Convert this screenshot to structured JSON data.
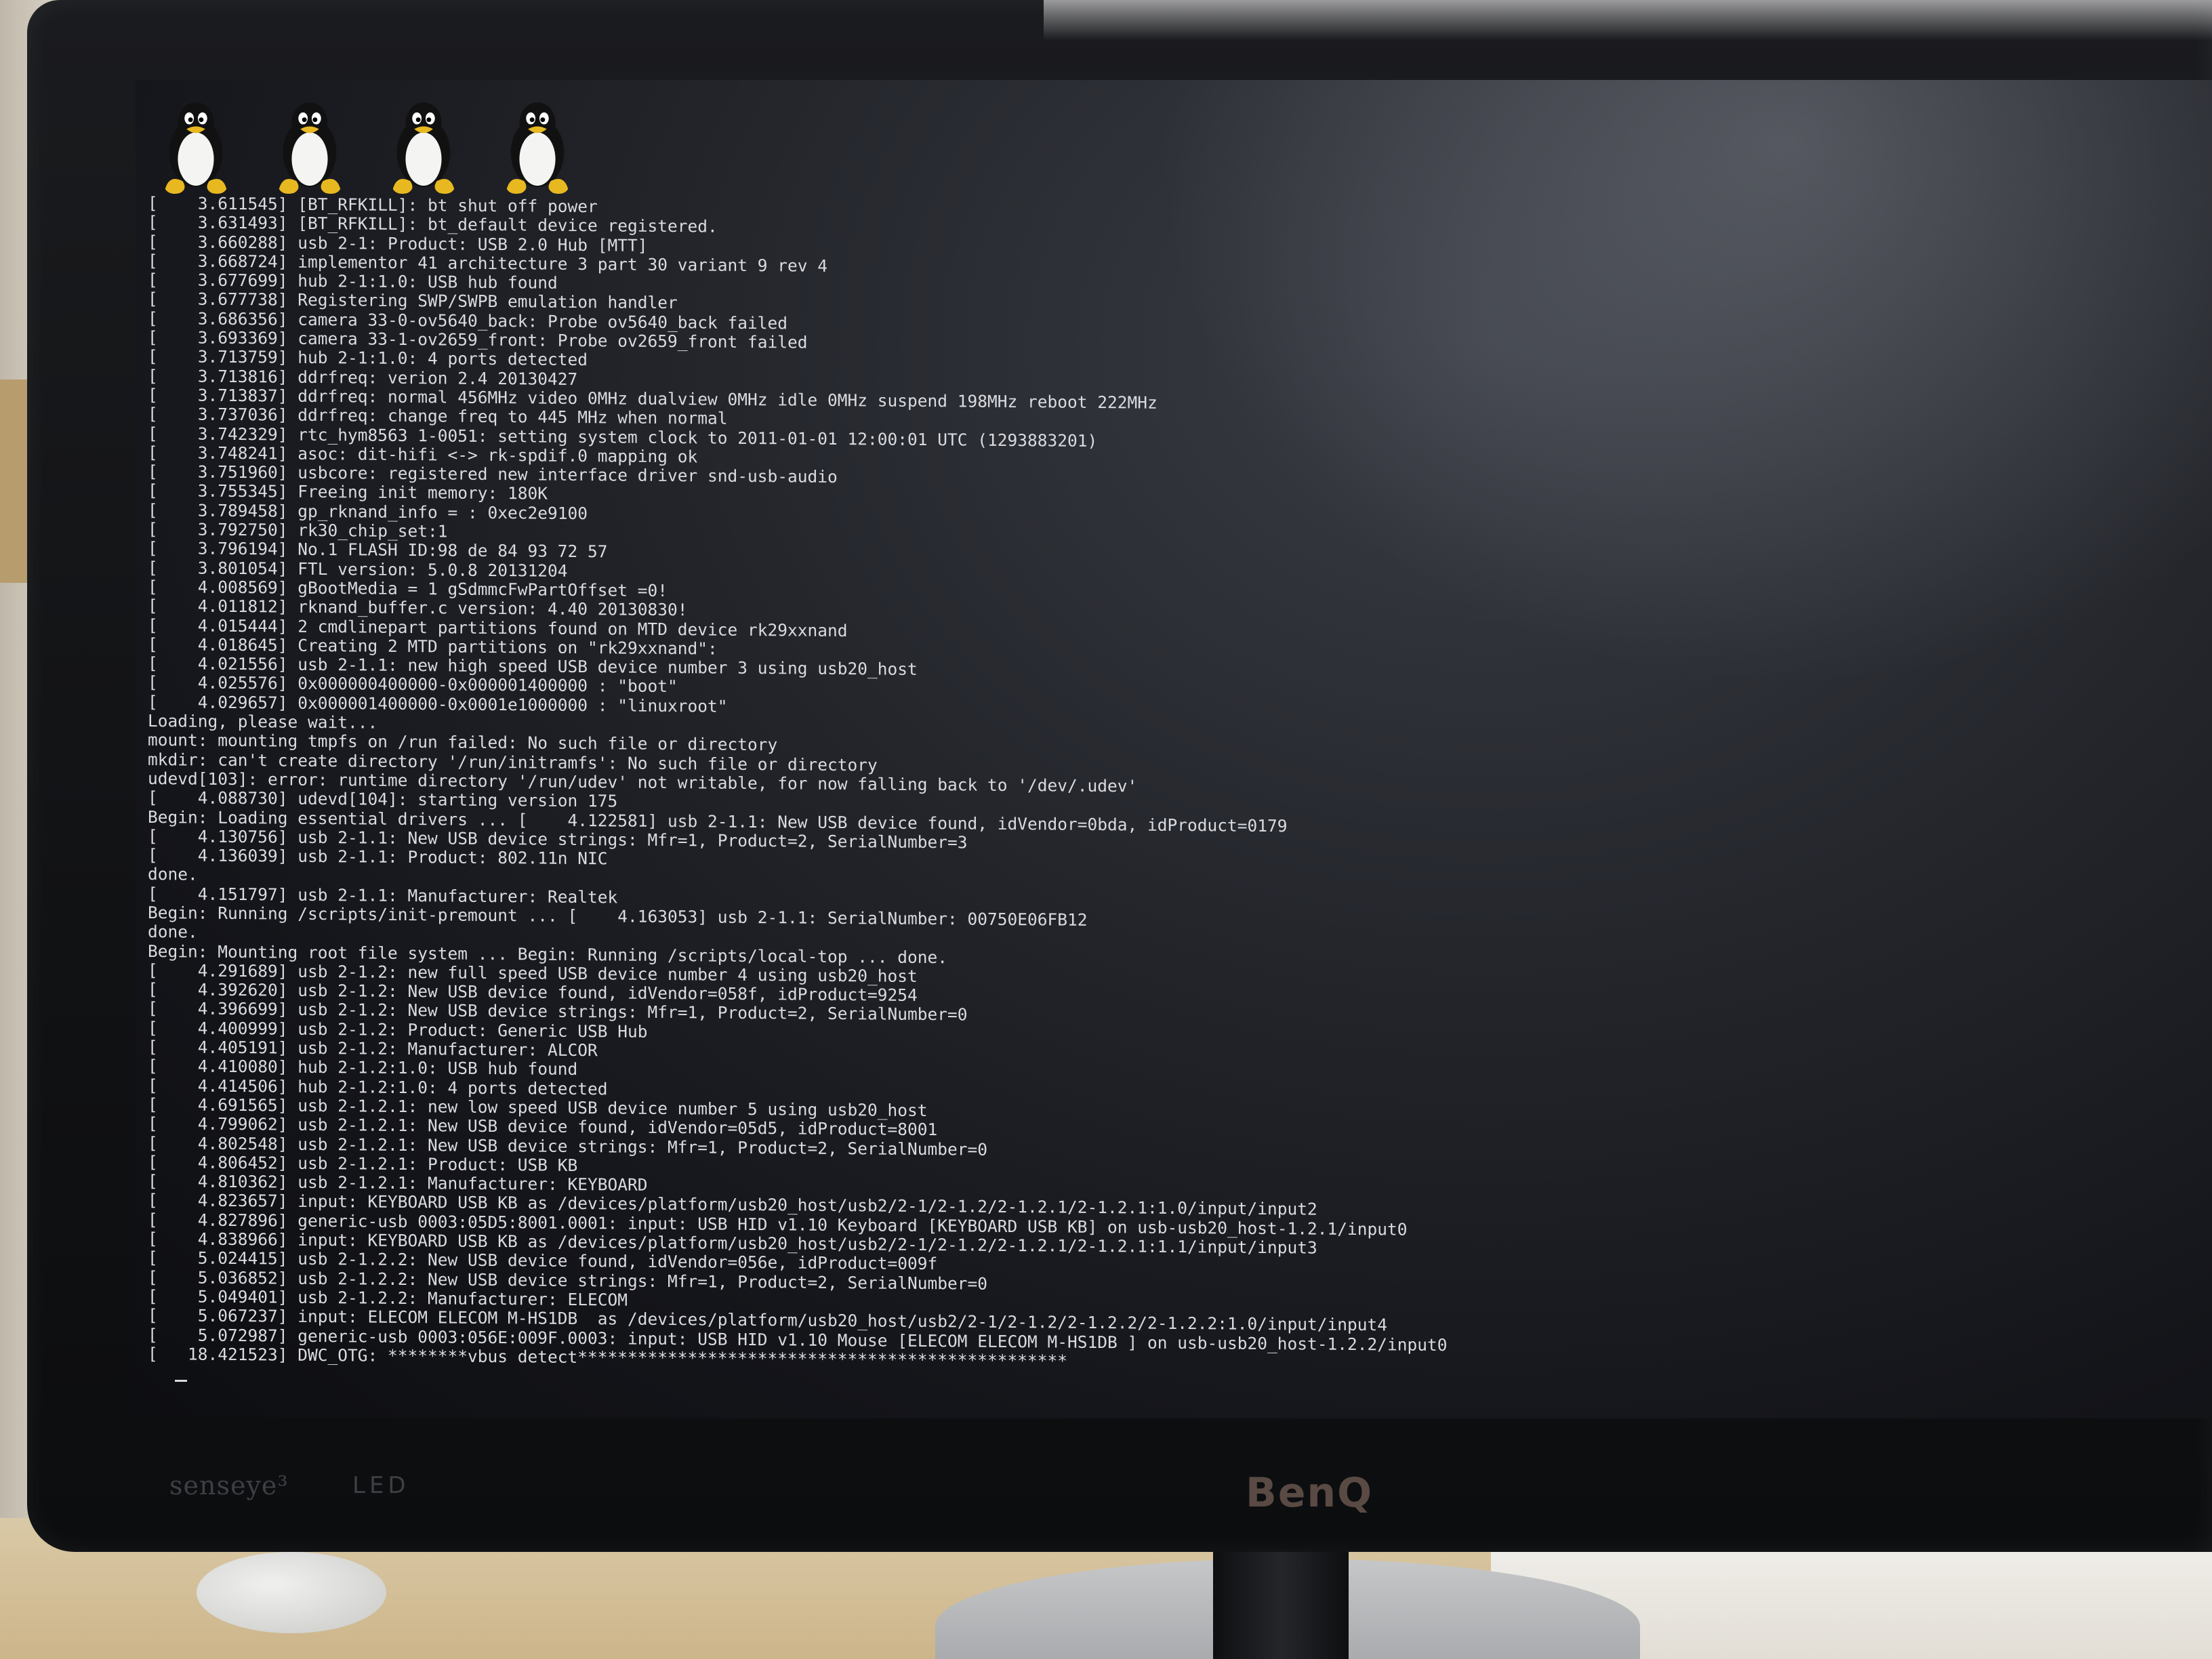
{
  "monitor": {
    "brand": "BenQ",
    "senseye_label": "senseye³",
    "led_label": "LED"
  },
  "screen": {
    "penguin_count": 4,
    "penguin_icon": "tux-penguin-icon",
    "console_lines": [
      "[    3.611545] [BT_RFKILL]: bt shut off power",
      "[    3.631493] [BT_RFKILL]: bt_default device registered.",
      "[    3.660288] usb 2-1: Product: USB 2.0 Hub [MTT]",
      "[    3.668724] implementor 41 architecture 3 part 30 variant 9 rev 4",
      "[    3.677699] hub 2-1:1.0: USB hub found",
      "[    3.677738] Registering SWP/SWPB emulation handler",
      "[    3.686356] camera 33-0-ov5640_back: Probe ov5640_back failed",
      "[    3.693369] camera 33-1-ov2659_front: Probe ov2659_front failed",
      "[    3.713759] hub 2-1:1.0: 4 ports detected",
      "[    3.713816] ddrfreq: verion 2.4 20130427",
      "[    3.713837] ddrfreq: normal 456MHz video 0MHz dualview 0MHz idle 0MHz suspend 198MHz reboot 222MHz",
      "[    3.737036] ddrfreq: change freq to 445 MHz when normal",
      "[    3.742329] rtc_hym8563 1-0051: setting system clock to 2011-01-01 12:00:01 UTC (1293883201)",
      "[    3.748241] asoc: dit-hifi <-> rk-spdif.0 mapping ok",
      "[    3.751960] usbcore: registered new interface driver snd-usb-audio",
      "[    3.755345] Freeing init memory: 180K",
      "[    3.789458] gp_rknand_info = : 0xec2e9100",
      "[    3.792750] rk30_chip_set:1",
      "[    3.796194] No.1 FLASH ID:98 de 84 93 72 57",
      "[    3.801054] FTL version: 5.0.8 20131204",
      "[    4.008569] gBootMedia = 1 gSdmmcFwPartOffset =0!",
      "[    4.011812] rknand_buffer.c version: 4.40 20130830!",
      "[    4.015444] 2 cmdlinepart partitions found on MTD device rk29xxnand",
      "[    4.018645] Creating 2 MTD partitions on \"rk29xxnand\":",
      "[    4.021556] usb 2-1.1: new high speed USB device number 3 using usb20_host",
      "[    4.025576] 0x000000400000-0x000001400000 : \"boot\"",
      "[    4.029657] 0x000001400000-0x0001e1000000 : \"linuxroot\"",
      "Loading, please wait...",
      "mount: mounting tmpfs on /run failed: No such file or directory",
      "mkdir: can't create directory '/run/initramfs': No such file or directory",
      "udevd[103]: error: runtime directory '/run/udev' not writable, for now falling back to '/dev/.udev'",
      "[    4.088730] udevd[104]: starting version 175",
      "Begin: Loading essential drivers ... [    4.122581] usb 2-1.1: New USB device found, idVendor=0bda, idProduct=0179",
      "[    4.130756] usb 2-1.1: New USB device strings: Mfr=1, Product=2, SerialNumber=3",
      "[    4.136039] usb 2-1.1: Product: 802.11n NIC",
      "done.",
      "[    4.151797] usb 2-1.1: Manufacturer: Realtek",
      "Begin: Running /scripts/init-premount ... [    4.163053] usb 2-1.1: SerialNumber: 00750E06FB12",
      "done.",
      "Begin: Mounting root file system ... Begin: Running /scripts/local-top ... done.",
      "[    4.291689] usb 2-1.2: new full speed USB device number 4 using usb20_host",
      "[    4.392620] usb 2-1.2: New USB device found, idVendor=058f, idProduct=9254",
      "[    4.396699] usb 2-1.2: New USB device strings: Mfr=1, Product=2, SerialNumber=0",
      "[    4.400999] usb 2-1.2: Product: Generic USB Hub",
      "[    4.405191] usb 2-1.2: Manufacturer: ALCOR",
      "[    4.410080] hub 2-1.2:1.0: USB hub found",
      "[    4.414506] hub 2-1.2:1.0: 4 ports detected",
      "[    4.691565] usb 2-1.2.1: new low speed USB device number 5 using usb20_host",
      "[    4.799062] usb 2-1.2.1: New USB device found, idVendor=05d5, idProduct=8001",
      "[    4.802548] usb 2-1.2.1: New USB device strings: Mfr=1, Product=2, SerialNumber=0",
      "[    4.806452] usb 2-1.2.1: Product: USB KB",
      "[    4.810362] usb 2-1.2.1: Manufacturer: KEYBOARD",
      "[    4.823657] input: KEYBOARD USB KB as /devices/platform/usb20_host/usb2/2-1/2-1.2/2-1.2.1/2-1.2.1:1.0/input/input2",
      "[    4.827896] generic-usb 0003:05D5:8001.0001: input: USB HID v1.10 Keyboard [KEYBOARD USB KB] on usb-usb20_host-1.2.1/input0",
      "[    4.838966] input: KEYBOARD USB KB as /devices/platform/usb20_host/usb2/2-1/2-1.2/2-1.2.1/2-1.2.1:1.1/input/input3",
      "[    5.024415] usb 2-1.2.2: New USB device found, idVendor=056e, idProduct=009f",
      "[    5.036852] usb 2-1.2.2: New USB device strings: Mfr=1, Product=2, SerialNumber=0",
      "[    5.049401] usb 2-1.2.2: Manufacturer: ELECOM",
      "[    5.067237] input: ELECOM ELECOM M-HS1DB  as /devices/platform/usb20_host/usb2/2-1/2-1.2/2-1.2.2/2-1.2.2:1.0/input/input4",
      "[    5.072987] generic-usb 0003:056E:009F.0003: input: USB HID v1.10 Mouse [ELECOM ELECOM M-HS1DB ] on usb-usb20_host-1.2.2/input0",
      "[   18.421523] DWC_OTG: ********vbus detect*************************************************"
    ]
  },
  "colors": {
    "console_text": "#d9dbe0",
    "screen_bg": "#1a1c21",
    "tux_body": "#111111",
    "tux_belly": "#f4f4f2",
    "tux_beak_feet": "#e8b820"
  }
}
